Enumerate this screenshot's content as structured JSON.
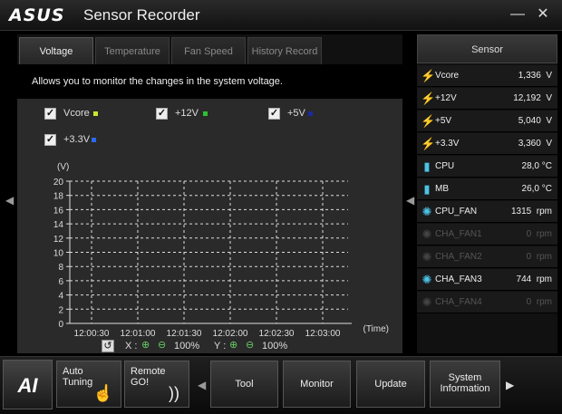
{
  "window": {
    "brand": "ASUS",
    "title": "Sensor Recorder",
    "minimize": "—",
    "close": "✕"
  },
  "tabs": [
    {
      "label": "Voltage",
      "active": true
    },
    {
      "label": "Temperature",
      "active": false
    },
    {
      "label": "Fan Speed",
      "active": false
    },
    {
      "label": "History Record",
      "active": false
    }
  ],
  "description": "Allows you to monitor the changes in the system voltage.",
  "checkboxes": [
    {
      "label": "Vcore",
      "checked": true,
      "color": "#c8e830"
    },
    {
      "label": "+12V",
      "checked": true,
      "color": "#30c030"
    },
    {
      "label": "+5V",
      "checked": true,
      "color": "#1a2aa0"
    },
    {
      "label": "+3.3V",
      "checked": true,
      "color": "#2a6af0"
    }
  ],
  "chart_data": {
    "type": "line",
    "ylabel": "(V)",
    "xlabel": "(Time)",
    "ylim": [
      0,
      20
    ],
    "yticks": [
      0,
      2,
      4,
      6,
      8,
      10,
      12,
      14,
      16,
      18,
      20
    ],
    "xticks": [
      "12:00:30",
      "12:01:00",
      "12:01:30",
      "12:02:00",
      "12:02:30",
      "12:03:00"
    ],
    "grid": true,
    "series": []
  },
  "zoom": {
    "x_label": "X :",
    "x_value": "100%",
    "y_label": "Y :",
    "y_value": "100%"
  },
  "sensor": {
    "header": "Sensor",
    "rows": [
      {
        "icon": "voltage-icon",
        "name": "Vcore",
        "value": "1,336  V",
        "dim": false
      },
      {
        "icon": "voltage-icon",
        "name": "+12V",
        "value": "12,192  V",
        "dim": false
      },
      {
        "icon": "voltage-icon",
        "name": "+5V",
        "value": "5,040  V",
        "dim": false
      },
      {
        "icon": "voltage-icon",
        "name": "+3.3V",
        "value": "3,360  V",
        "dim": false
      },
      {
        "icon": "thermometer-icon",
        "name": "CPU",
        "value": "28,0 °C",
        "dim": false
      },
      {
        "icon": "thermometer-icon",
        "name": "MB",
        "value": "26,0 °C",
        "dim": false
      },
      {
        "icon": "fan-icon",
        "name": "CPU_FAN",
        "value": "1315  rpm",
        "dim": false
      },
      {
        "icon": "fan-icon",
        "name": "CHA_FAN1",
        "value": "0  rpm",
        "dim": true
      },
      {
        "icon": "fan-icon",
        "name": "CHA_FAN2",
        "value": "0  rpm",
        "dim": true
      },
      {
        "icon": "fan-icon",
        "name": "CHA_FAN3",
        "value": "744  rpm",
        "dim": false
      },
      {
        "icon": "fan-icon",
        "name": "CHA_FAN4",
        "value": "0  rpm",
        "dim": true
      }
    ]
  },
  "bottom": {
    "logo": "AI",
    "auto_tuning": "Auto\nTuning",
    "remote_go": "Remote\nGO!",
    "tool": "Tool",
    "monitor": "Monitor",
    "update": "Update",
    "system_information": "System\nInformation"
  }
}
